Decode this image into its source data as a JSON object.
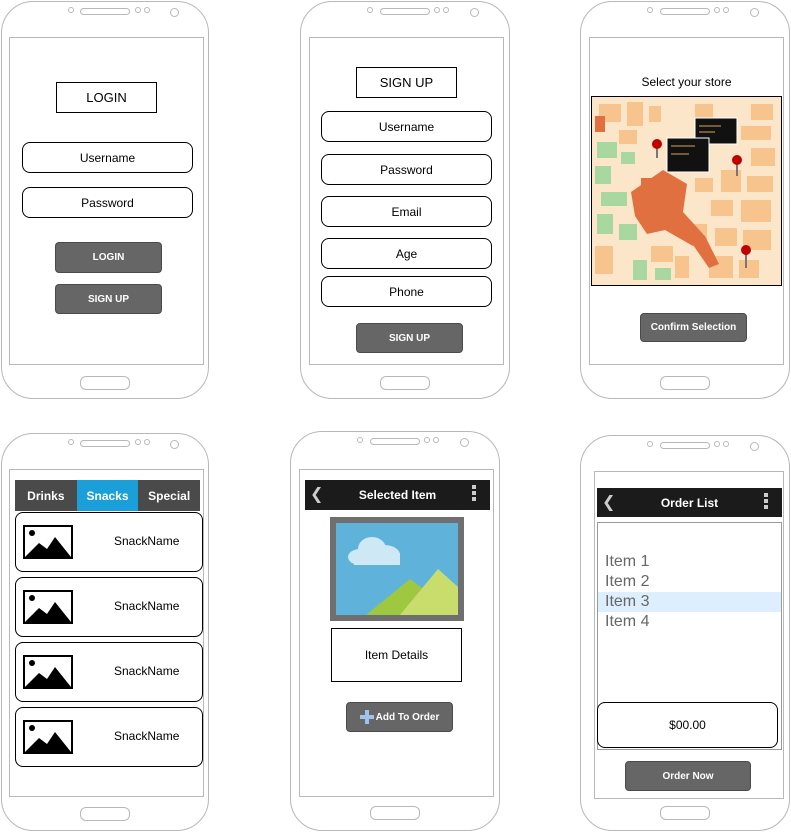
{
  "login_screen": {
    "title": "LOGIN",
    "username_label": "Username",
    "password_label": "Password",
    "login_button": "LOGIN",
    "signup_button": "SIGN UP"
  },
  "signup_screen": {
    "title": "SIGN UP",
    "fields": [
      "Username",
      "Password",
      "Email",
      "Age",
      "Phone"
    ],
    "signup_button": "SIGN UP"
  },
  "store_screen": {
    "title": "Select your store",
    "confirm_button": "Confirm Selection",
    "map_icon": "map-with-pins-icon"
  },
  "snacks_screen": {
    "tabs": [
      "Drinks",
      "Snacks",
      "Special"
    ],
    "active_tab": "Snacks",
    "items": [
      "SnackName",
      "SnackName",
      "SnackName",
      "SnackName"
    ],
    "accent_color": "#1a9fd8"
  },
  "item_screen": {
    "title": "Selected Item",
    "details": "Item Details",
    "add_button": "Add To Order",
    "image_icon": "landscape-image-icon"
  },
  "order_screen": {
    "title": "Order List",
    "items": [
      "Item 1",
      "Item 2",
      "Item 3",
      "Item 4"
    ],
    "selected_item": "Item 3",
    "total": "$00.00",
    "order_button": "Order Now"
  }
}
